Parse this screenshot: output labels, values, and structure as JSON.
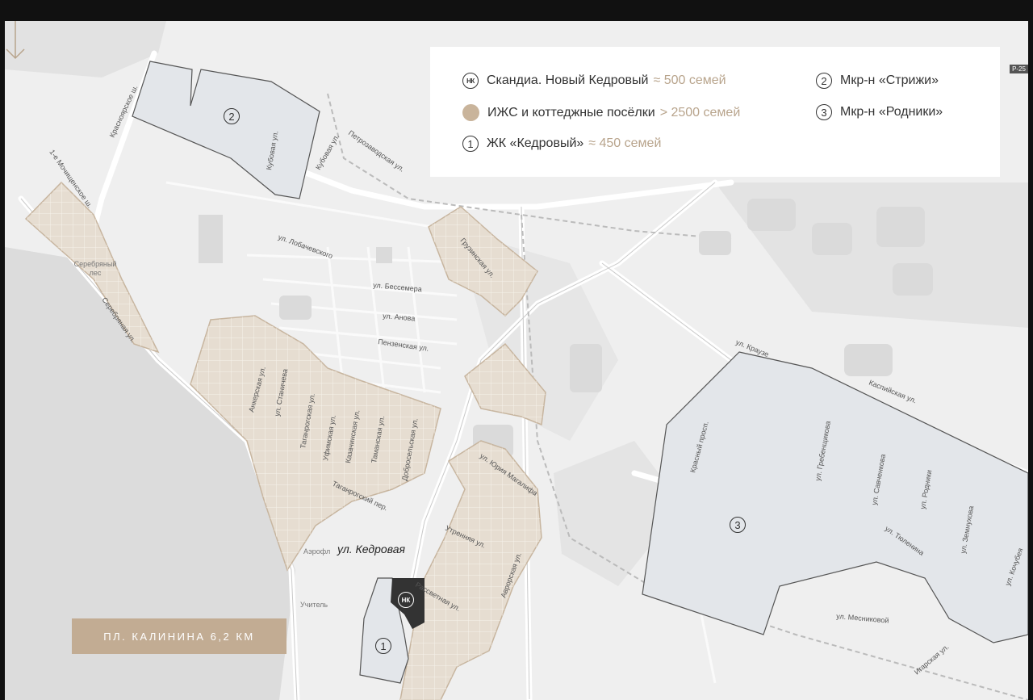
{
  "legend": {
    "items": [
      {
        "badge": "НК",
        "name": "Скандиа. Новый Кедровый",
        "approx": "≈ 500 семей"
      },
      {
        "name": "ИЖС и коттеджные посёлки",
        "approx": "> 2500 семей"
      },
      {
        "badge": "1",
        "name": "ЖК «Кедровый»",
        "approx": "≈ 450 семей"
      },
      {
        "badge": "2",
        "name": "Мкр-н «Стрижи»"
      },
      {
        "badge": "3",
        "name": "Мкр-н «Родники»"
      }
    ]
  },
  "distance_label": "ПЛ. КАЛИНИНА 6,2 КМ",
  "kedrovaya_label": "ул. Кедровая",
  "zones": {
    "one": "1",
    "two": "2",
    "three": "3",
    "nk": "НК"
  },
  "places": {
    "silver_forest": "Серебряный лес",
    "aero": "Аэрофл",
    "teacher": "Учитель"
  },
  "road_tag": "Р-25",
  "streets": {
    "kubovaya": "Кубовая ул.",
    "kubovaya2": "Кубовая ул.",
    "petrozavodskaya": "Петрозаводская ул.",
    "krasnoyarsk": "Красноярское ш.",
    "mochishchenskaya": "1-е Мочищенское ш.",
    "lobachevskogo": "ул. Лобачевского",
    "bessemera": "ул. Бессемера",
    "anosova": "ул. Анова",
    "penzenskaya": "Пензенская ул.",
    "gruzinskaya": "Грузинская ул.",
    "serebryanaya": "Серебряная ул.",
    "ankerskaya": "Анкерская ул.",
    "stanicheva": "ул. Станичева",
    "taganrogskaya": "Таганрогская ул.",
    "ufimskaya": "Уфимская ул.",
    "kazachinskaya": "Казачинская ул.",
    "tamanskaya": "Таманская ул.",
    "dobrosolskaya": "Добросельская ул.",
    "taganrogsky_per": "Таганрогский пер.",
    "yuriya_magalifa": "ул. Юрия Магалифа",
    "utrennyaya": "Утренняя ул.",
    "rassvetnaya": "Рассветная ул.",
    "avrorovskaya": "Аврорская ул.",
    "krause": "ул. Краузе",
    "kaspiyskaya": "Каспийская ул.",
    "krasny_prosp": "Красный просп.",
    "grebenshchikova": "ул. Гребенщикова",
    "savchenkova": "ул. Савченкова",
    "rodniki": "ул. Родники",
    "zemnukhova": "ул. Земнухова",
    "kochubeya": "ул. Кочубея",
    "tyulenina": "ул. Тюленина",
    "mesnikovoy": "ул. Месниковой",
    "igarskaya": "Игарская ул."
  }
}
